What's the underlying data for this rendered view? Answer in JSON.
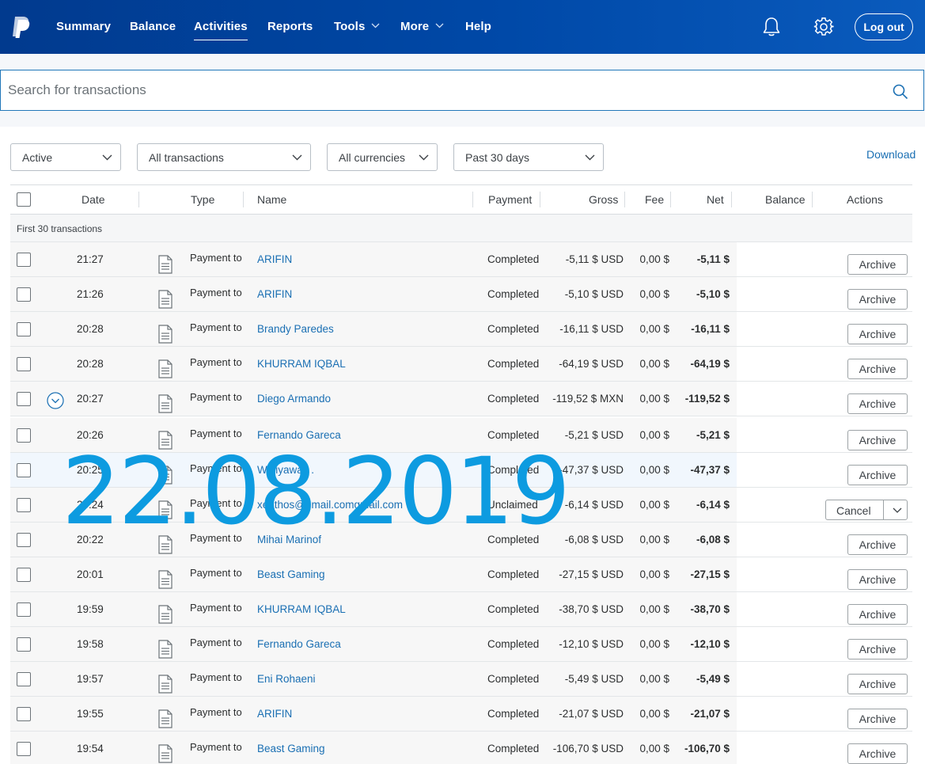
{
  "nav": {
    "items": [
      {
        "label": "Summary",
        "dropdown": false,
        "active": false
      },
      {
        "label": "Balance",
        "dropdown": false,
        "active": false
      },
      {
        "label": "Activities",
        "dropdown": false,
        "active": true
      },
      {
        "label": "Reports",
        "dropdown": false,
        "active": false
      },
      {
        "label": "Tools",
        "dropdown": true,
        "active": false
      },
      {
        "label": "More",
        "dropdown": true,
        "active": false
      },
      {
        "label": "Help",
        "dropdown": false,
        "active": false
      }
    ],
    "logout_label": "Log out",
    "icons": [
      "paypal-logo",
      "bell-icon",
      "gear-icon"
    ]
  },
  "search": {
    "placeholder": "Search for transactions"
  },
  "filters": {
    "status": "Active",
    "type": "All transactions",
    "currency": "All currencies",
    "period": "Past 30 days",
    "download_label": "Download"
  },
  "table": {
    "headers": {
      "date": "Date",
      "type": "Type",
      "name": "Name",
      "payment": "Payment",
      "gross": "Gross",
      "fee": "Fee",
      "net": "Net",
      "balance": "Balance",
      "actions": "Actions"
    },
    "group_label": "First 30 transactions",
    "rows": [
      {
        "time": "21:27",
        "type": "Payment to",
        "name": "ARIFIN",
        "status": "Completed",
        "gross": "-5,11 $ USD",
        "fee": "0,00 $",
        "net": "-5,11 $",
        "action": "Archive"
      },
      {
        "time": "21:26",
        "type": "Payment to",
        "name": "ARIFIN",
        "status": "Completed",
        "gross": "-5,10 $ USD",
        "fee": "0,00 $",
        "net": "-5,10 $",
        "action": "Archive"
      },
      {
        "time": "20:28",
        "type": "Payment to",
        "name": "Brandy Paredes",
        "status": "Completed",
        "gross": "-16,11 $ USD",
        "fee": "0,00 $",
        "net": "-16,11 $",
        "action": "Archive"
      },
      {
        "time": "20:28",
        "type": "Payment to",
        "name": "KHURRAM IQBAL",
        "status": "Completed",
        "gross": "-64,19 $ USD",
        "fee": "0,00 $",
        "net": "-64,19 $",
        "action": "Archive"
      },
      {
        "time": "20:27",
        "type": "Payment to",
        "name": "Diego Armando",
        "status": "Completed",
        "gross": "-119,52 $ MXN",
        "fee": "0,00 $",
        "net": "-119,52 $",
        "action": "Archive",
        "expand": true
      },
      {
        "time": "20:26",
        "type": "Payment to",
        "name": "Fernando Gareca",
        "status": "Completed",
        "gross": "-5,21 $ USD",
        "fee": "0,00 $",
        "net": "-5,21 $",
        "action": "Archive"
      },
      {
        "time": "20:25",
        "type": "Payment to",
        "name": "Widiyawati .",
        "status": "Completed",
        "gross": "-47,37 $ USD",
        "fee": "0,00 $",
        "net": "-47,37 $",
        "action": "Archive",
        "highlight": true
      },
      {
        "time": "20:24",
        "type": "Payment to",
        "name": "xenthos@gmail.comgmail.com",
        "status": "Unclaimed",
        "gross": "-6,14 $ USD",
        "fee": "0,00 $",
        "net": "-6,14 $",
        "action": "Cancel"
      },
      {
        "time": "20:22",
        "type": "Payment to",
        "name": "Mihai Marinof",
        "status": "Completed",
        "gross": "-6,08 $ USD",
        "fee": "0,00 $",
        "net": "-6,08 $",
        "action": "Archive"
      },
      {
        "time": "20:01",
        "type": "Payment to",
        "name": "Beast Gaming",
        "status": "Completed",
        "gross": "-27,15 $ USD",
        "fee": "0,00 $",
        "net": "-27,15 $",
        "action": "Archive"
      },
      {
        "time": "19:59",
        "type": "Payment to",
        "name": "KHURRAM IQBAL",
        "status": "Completed",
        "gross": "-38,70 $ USD",
        "fee": "0,00 $",
        "net": "-38,70 $",
        "action": "Archive"
      },
      {
        "time": "19:58",
        "type": "Payment to",
        "name": "Fernando Gareca",
        "status": "Completed",
        "gross": "-12,10 $ USD",
        "fee": "0,00 $",
        "net": "-12,10 $",
        "action": "Archive"
      },
      {
        "time": "19:57",
        "type": "Payment to",
        "name": "Eni Rohaeni",
        "status": "Completed",
        "gross": "-5,49 $ USD",
        "fee": "0,00 $",
        "net": "-5,49 $",
        "action": "Archive"
      },
      {
        "time": "19:55",
        "type": "Payment to",
        "name": "ARIFIN",
        "status": "Completed",
        "gross": "-21,07 $ USD",
        "fee": "0,00 $",
        "net": "-21,07 $",
        "action": "Archive"
      },
      {
        "time": "19:54",
        "type": "Payment to",
        "name": "Beast Gaming",
        "status": "Completed",
        "gross": "-106,70 $ USD",
        "fee": "0,00 $",
        "net": "-106,70 $",
        "action": "Archive"
      }
    ]
  },
  "overlay": {
    "date_text": "22.08.2019"
  },
  "colors": {
    "nav_bg": "#0049a8",
    "link": "#1a6fb3",
    "watermark": "#0d9be0"
  }
}
